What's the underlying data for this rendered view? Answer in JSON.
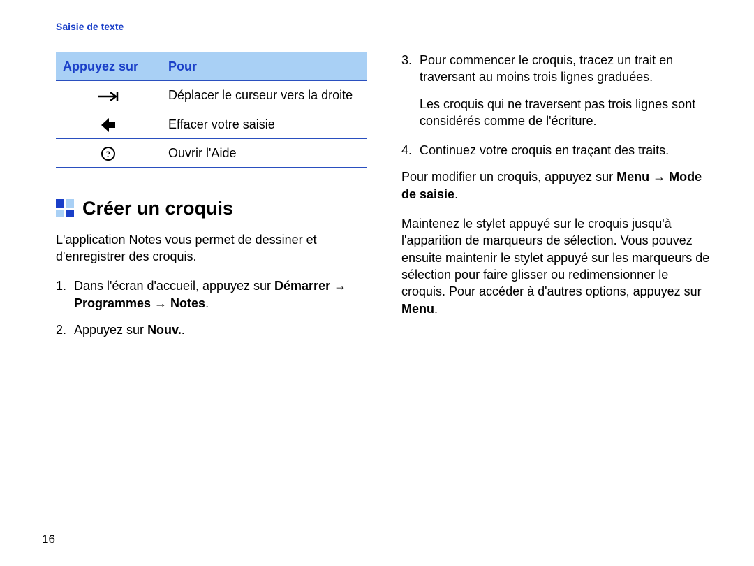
{
  "header": {
    "link": "Saisie de texte"
  },
  "table": {
    "head": {
      "col1": "Appuyez sur",
      "col2": "Pour"
    },
    "rows": [
      {
        "icon": "arrow-right-long-icon",
        "desc": "Déplacer le curseur vers la droite"
      },
      {
        "icon": "arrow-left-delete-icon",
        "desc": "Effacer votre saisie"
      },
      {
        "icon": "help-circle-icon",
        "desc": "Ouvrir l'Aide"
      }
    ]
  },
  "section": {
    "title": "Créer un croquis",
    "intro": "L'application Notes vous permet de dessiner et d'enregistrer des croquis.",
    "steps_left": {
      "s1_prefix": "Dans l'écran d'accueil, appuyez sur ",
      "s1_bold": "Démarrer → Programmes → Notes",
      "s1_suffix": ".",
      "s2_prefix": "Appuyez sur ",
      "s2_bold": "Nouv.",
      "s2_suffix": "."
    },
    "steps_right": {
      "s3": "Pour commencer le croquis, tracez un trait en traversant au moins trois lignes graduées.",
      "s3_extra": "Les croquis qui ne traversent pas trois lignes sont considérés comme de l'écriture.",
      "s4": "Continuez votre croquis en traçant des traits."
    },
    "after": {
      "p1_prefix": "Pour modifier un croquis, appuyez sur ",
      "p1_bold": "Menu → Mode de saisie",
      "p1_suffix": ".",
      "p2_prefix": "Maintenez le stylet appuyé sur le croquis jusqu'à l'apparition de marqueurs de sélection. Vous pouvez ensuite maintenir le stylet appuyé sur les marqueurs de sélection pour faire glisser ou redimensionner le croquis. Pour accéder à d'autres options, appuyez sur ",
      "p2_bold": "Menu",
      "p2_suffix": "."
    }
  },
  "page_number": "16"
}
